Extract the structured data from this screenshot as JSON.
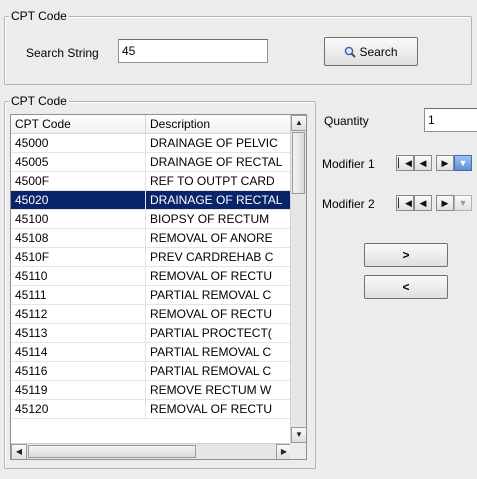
{
  "search_group": {
    "title": "CPT Code",
    "search_label": "Search String",
    "search_value": "45",
    "search_button_label": "Search"
  },
  "list_group": {
    "title": "CPT Code",
    "columns": [
      "CPT Code",
      "Description"
    ],
    "rows": [
      {
        "code": "45000",
        "desc": "DRAINAGE OF PELVIC"
      },
      {
        "code": "45005",
        "desc": "DRAINAGE OF RECTAL"
      },
      {
        "code": "4500F",
        "desc": "REF TO OUTPT CARD"
      },
      {
        "code": "45020",
        "desc": "DRAINAGE OF RECTAL",
        "selected": true
      },
      {
        "code": "45100",
        "desc": "BIOPSY OF RECTUM"
      },
      {
        "code": "45108",
        "desc": "REMOVAL OF ANORE"
      },
      {
        "code": "4510F",
        "desc": "PREV CARDREHAB C"
      },
      {
        "code": "45110",
        "desc": "REMOVAL OF RECTU"
      },
      {
        "code": "45111",
        "desc": "PARTIAL REMOVAL C"
      },
      {
        "code": "45112",
        "desc": "REMOVAL OF RECTU"
      },
      {
        "code": "45113",
        "desc": "PARTIAL PROCTECT("
      },
      {
        "code": "45114",
        "desc": "PARTIAL REMOVAL C"
      },
      {
        "code": "45116",
        "desc": "PARTIAL REMOVAL C"
      },
      {
        "code": "45119",
        "desc": "REMOVE RECTUM W"
      },
      {
        "code": "45120",
        "desc": "REMOVAL OF RECTU"
      }
    ]
  },
  "quantity": {
    "label": "Quantity",
    "value": "1"
  },
  "modifier1": {
    "label": "Modifier 1"
  },
  "modifier2": {
    "label": "Modifier 2"
  },
  "buttons": {
    "add_label": ">",
    "remove_label": "<"
  },
  "colors": {
    "selection": "#0a246a",
    "background": "#ececec",
    "border": "#b4b4b4"
  }
}
